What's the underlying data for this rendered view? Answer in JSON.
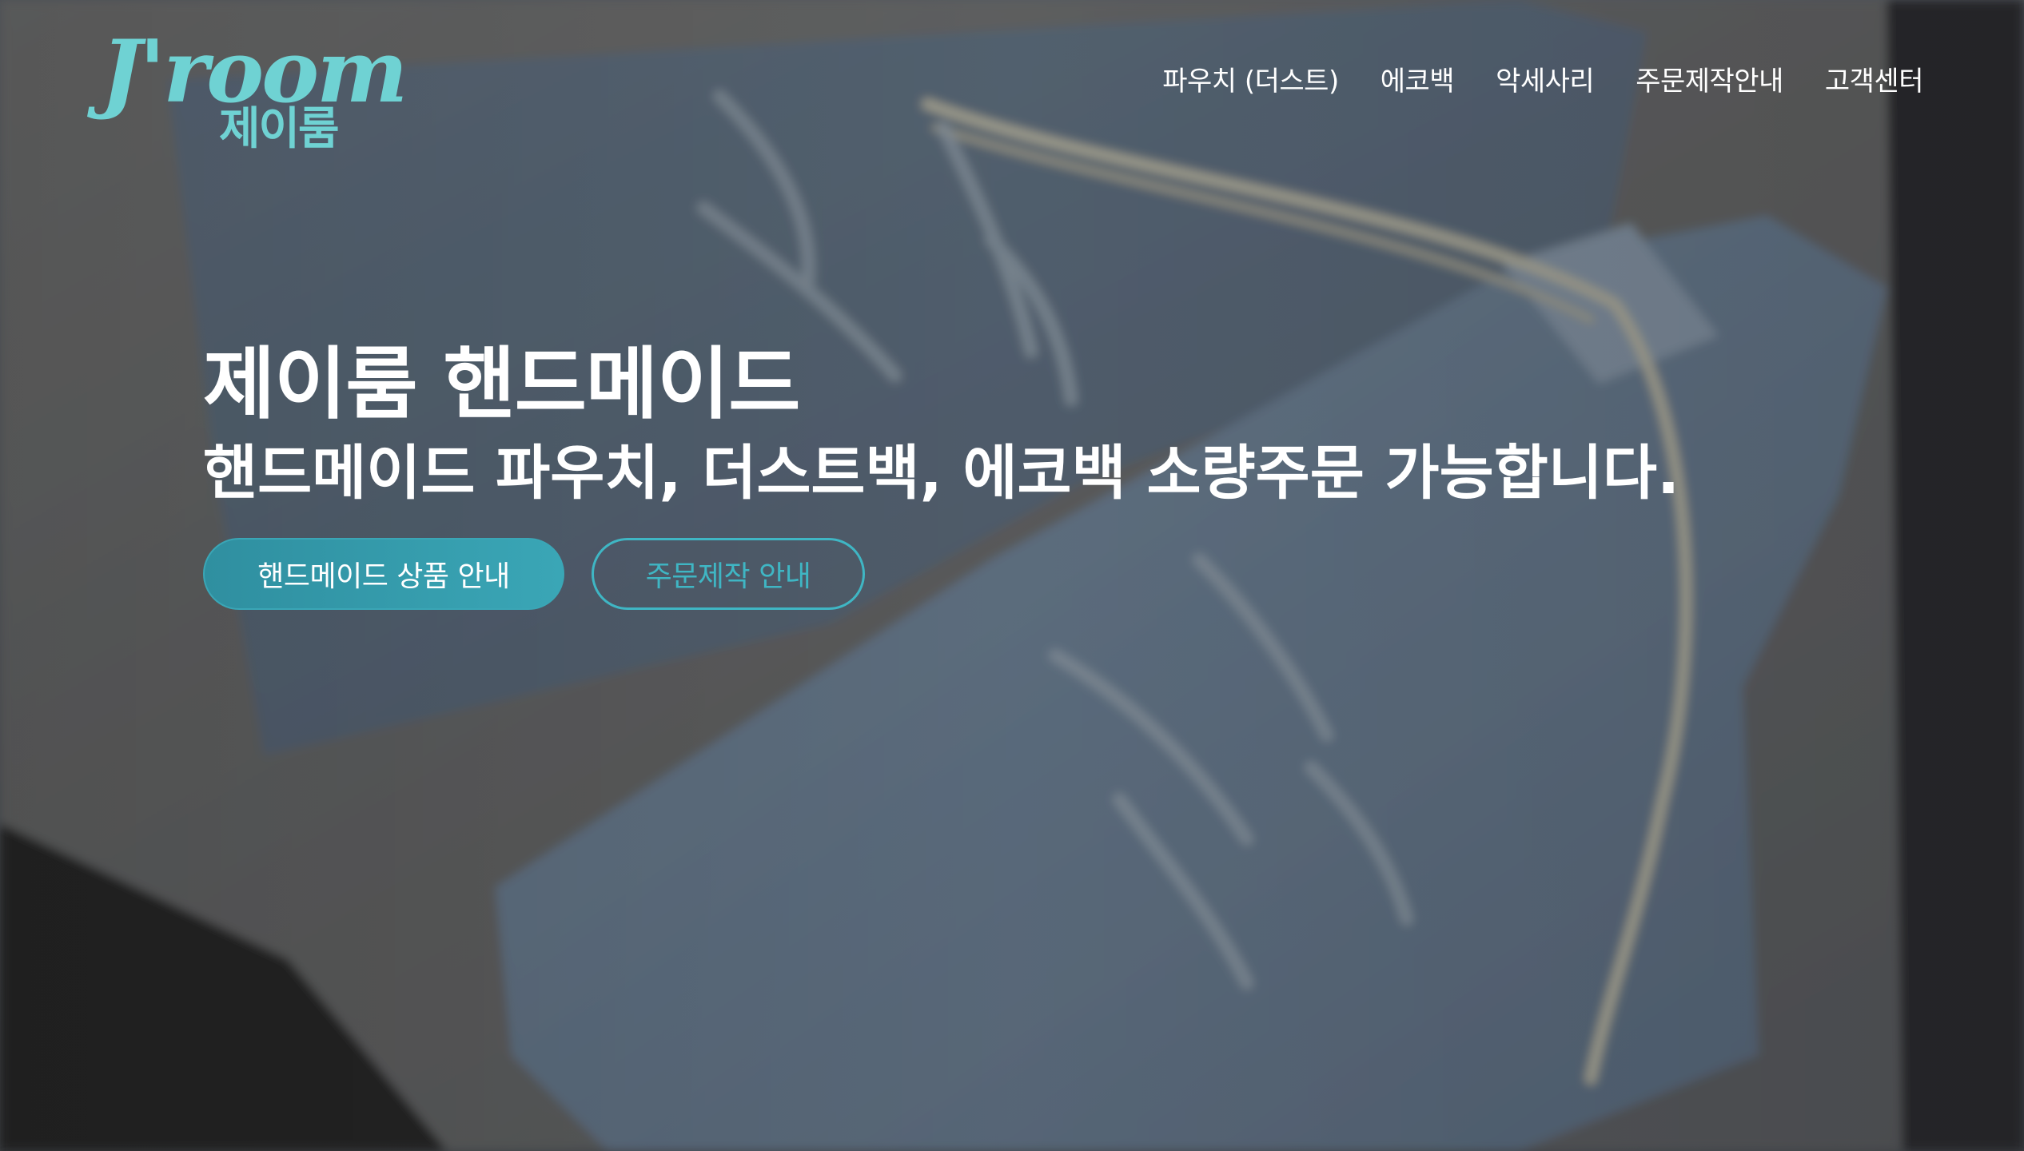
{
  "brand": {
    "logo_latin": "J'room",
    "logo_korean": "제이룸",
    "color": "#6fd2d3"
  },
  "nav": {
    "items": [
      {
        "label": "파우치 (더스트)"
      },
      {
        "label": "에코백"
      },
      {
        "label": "악세사리"
      },
      {
        "label": "주문제작안내"
      },
      {
        "label": "고객센터"
      }
    ]
  },
  "hero": {
    "title": "제이룸 핸드메이드",
    "subtitle": "핸드메이드 파우치, 더스트백, 에코백 소량주문 가능합니다.",
    "primary_button": "핸드메이드 상품 안내",
    "secondary_button": "주문제작 안내",
    "accent_color": "#3aa6b6",
    "background_image": "blurred-photo-of-light-blue-drawstring-pouches"
  }
}
